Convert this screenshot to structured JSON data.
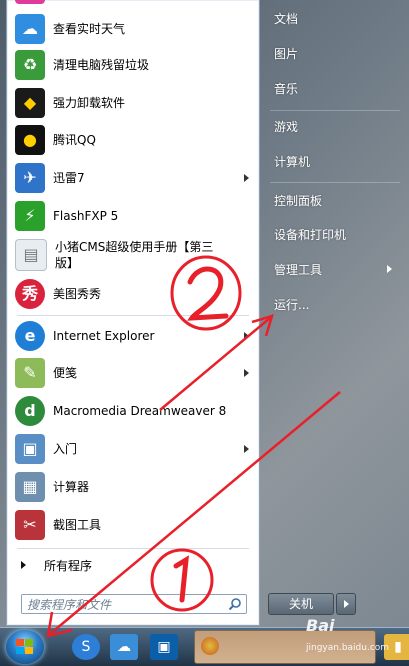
{
  "left_menu": {
    "items": [
      {
        "label": "查看实时天气",
        "icon": "weather-icon",
        "color": "#2f8ee0"
      },
      {
        "label": "清理电脑残留垃圾",
        "icon": "recycle-icon",
        "color": "#3a9b3a"
      },
      {
        "label": "强力卸载软件",
        "icon": "uninstall-icon",
        "color": "#1a1a1a"
      },
      {
        "label": "腾讯QQ",
        "icon": "qq-penguin-icon",
        "color": "#111111"
      },
      {
        "label": "迅雷7",
        "icon": "thunder-bird-icon",
        "color": "#2f74c8",
        "has_submenu": true
      },
      {
        "label": "FlashFXP 5",
        "icon": "flashfxp-icon",
        "color": "#2aa12a"
      },
      {
        "label": "小猪CMS超级使用手册【第三版】",
        "icon": "document-icon",
        "color": "#cfd6de"
      },
      {
        "label": "美图秀秀",
        "icon": "meitu-icon",
        "color": "#d9223c"
      },
      {
        "label": "Internet Explorer",
        "icon": "ie-icon",
        "color": "#1f7fd6",
        "has_submenu": true
      },
      {
        "label": "便笺",
        "icon": "sticky-notes-icon",
        "color": "#8dbb5a",
        "has_submenu": true
      },
      {
        "label": "Macromedia Dreamweaver 8",
        "icon": "dreamweaver-icon",
        "color": "#2e8b3c"
      },
      {
        "label": "入门",
        "icon": "getting-started-icon",
        "color": "#5a8fc6",
        "has_submenu": true
      },
      {
        "label": "计算器",
        "icon": "calculator-icon",
        "color": "#6f8fae"
      },
      {
        "label": "截图工具",
        "icon": "snipping-tool-icon",
        "color": "#b8333a"
      }
    ],
    "all_programs": "所有程序",
    "search_placeholder": "搜索程序和文件"
  },
  "right_menu": {
    "items": [
      {
        "label": "文档"
      },
      {
        "label": "图片"
      },
      {
        "label": "音乐"
      },
      {
        "label": "游戏"
      },
      {
        "label": "计算机"
      },
      {
        "label": "控制面板"
      },
      {
        "label": "设备和打印机"
      },
      {
        "label": "管理工具",
        "has_submenu": true
      },
      {
        "label": "运行..."
      }
    ],
    "shutdown": "关机"
  },
  "annotations": {
    "circle_one": "①",
    "circle_two": "②",
    "color": "#e8202a"
  },
  "watermark": {
    "brand": "Bai",
    "site": "jingyan.baidu.com"
  }
}
